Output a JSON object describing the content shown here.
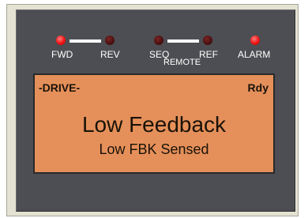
{
  "indicators": {
    "fwd": {
      "label": "FWD",
      "state": "on"
    },
    "rev": {
      "label": "REV",
      "state": "off"
    },
    "seq": {
      "label": "SEQ",
      "state": "off"
    },
    "ref": {
      "label": "REF",
      "state": "off"
    },
    "alarm": {
      "label": "ALARM",
      "state": "on"
    },
    "remote_label": "REMOTE"
  },
  "display": {
    "mode": "-DRIVE-",
    "status": "Rdy",
    "message": "Low Feedback",
    "detail": "Low FBK Sensed"
  },
  "colors": {
    "panel": "#4d4e53",
    "frame": "#e4e2d2",
    "lcd_background": "#e5905a",
    "led_on": "#f01414",
    "led_off": "#4a1010"
  }
}
